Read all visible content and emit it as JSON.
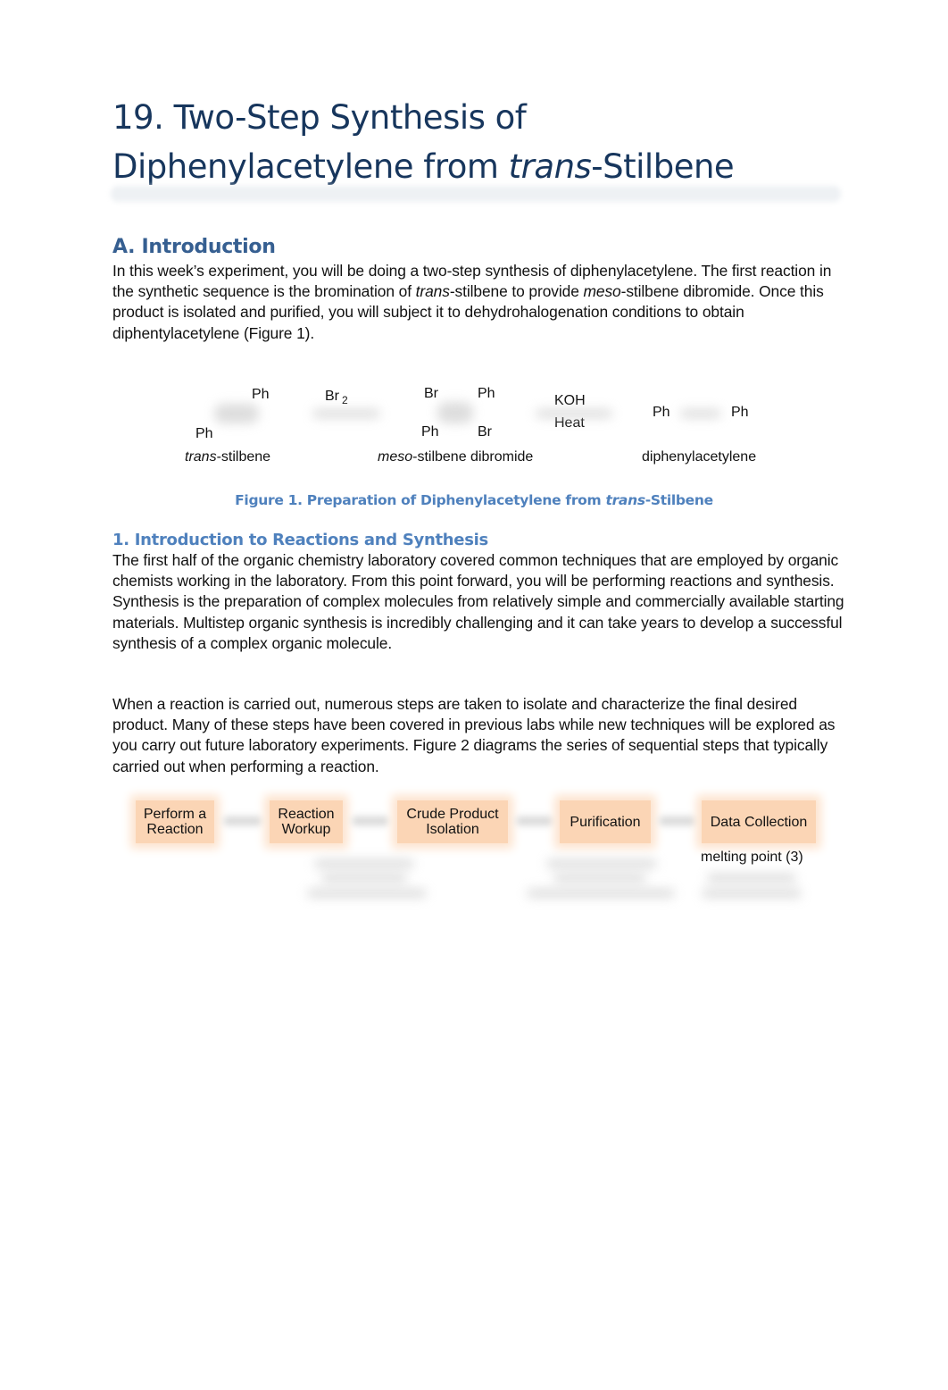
{
  "title": {
    "line1": "19. Two-Step Synthesis of",
    "line2_prefix": "Diphenylacetylene from ",
    "line2_italic": "trans",
    "line2_suffix": "-Stilbene"
  },
  "intro": {
    "heading": "A. Introduction",
    "p_a": "In this week’s experiment, you will be doing a two-step synthesis of diphenylacetylene. The first reaction in the synthetic sequence is the bromination of ",
    "p_italic1": "trans",
    "p_b": "-stilbene to provide ",
    "p_italic2": "meso",
    "p_c": "-stilbene dibromide. Once this product is isolated and purified, you will subject it to dehydrohalogenation conditions to obtain diphentylacetylene (Figure 1)."
  },
  "figure1": {
    "trans_stilbene": {
      "ph_top": "Ph",
      "ph_bottom": "Ph",
      "label_italic": "trans",
      "label_rest": "-stilbene"
    },
    "reagent1": {
      "text": "Br",
      "sub": "2"
    },
    "dibromide": {
      "br_top": "Br",
      "ph_top": "Ph",
      "ph_bottom": "Ph",
      "br_bottom": "Br",
      "label_italic": "meso",
      "label_rest": "-stilbene dibromide"
    },
    "reagent2": {
      "line1": "KOH",
      "line2": "Heat"
    },
    "product": {
      "ph_left": "Ph",
      "ph_right": "Ph",
      "label": "diphenylacetylene"
    },
    "caption_prefix": "Figure 1. Preparation of Diphenylacetylene from ",
    "caption_italic": "trans",
    "caption_suffix": "-Stilbene"
  },
  "section1": {
    "heading": "1. Introduction to Reactions and Synthesis",
    "p1": "The first half of the organic chemistry laboratory covered common techniques that are employed by organic chemists working in the laboratory. From this point forward, you will be performing reactions and synthesis. Synthesis is the preparation of complex molecules from relatively simple and commercially available starting materials. Multistep organic synthesis is incredibly challenging and it can take years to develop a successful synthesis of a complex organic molecule.",
    "p2": "When a reaction is carried out, numerous steps are taken to isolate and characterize the final desired product. Many of these steps have been covered in previous labs while new techniques will be explored as you carry out future laboratory experiments. Figure 2 diagrams the series of sequential steps that typically carried out when performing a reaction."
  },
  "flow": {
    "steps": [
      {
        "line1": "Perform a",
        "line2": "Reaction"
      },
      {
        "line1": "Reaction",
        "line2": "Workup"
      },
      {
        "line1": "Crude Product",
        "line2": "Isolation"
      },
      {
        "line1": "Purification",
        "line2": ""
      },
      {
        "line1": "Data Collection",
        "line2": ""
      }
    ],
    "data_collection_note": "melting point (3)",
    "box_color": "#fbd5b5"
  },
  "colors": {
    "title": "#17365d",
    "heading": "#365f91",
    "subheading": "#4f81bd"
  }
}
